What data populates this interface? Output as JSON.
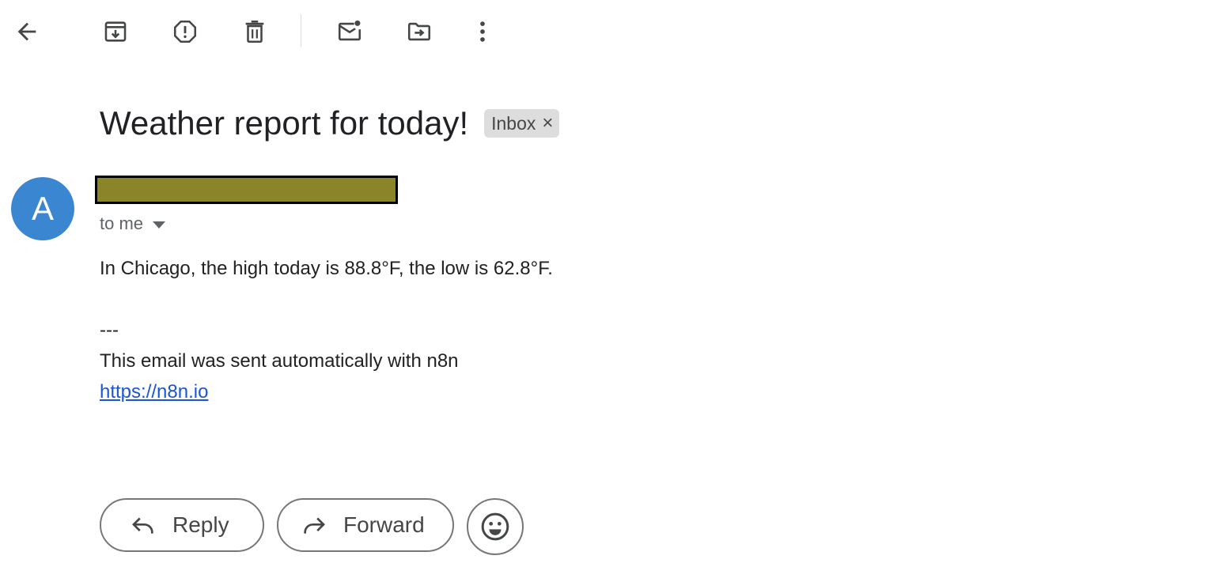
{
  "toolbar": {
    "buttons": [
      {
        "name": "back-button",
        "icon": "arrow-left-icon"
      },
      {
        "name": "archive-button",
        "icon": "archive-icon"
      },
      {
        "name": "report-spam-button",
        "icon": "report-spam-icon"
      },
      {
        "name": "delete-button",
        "icon": "trash-icon"
      },
      {
        "name": "mark-unread-button",
        "icon": "mail-unread-icon"
      },
      {
        "name": "move-to-button",
        "icon": "folder-move-icon"
      },
      {
        "name": "more-options-button",
        "icon": "more-vert-icon"
      }
    ]
  },
  "email": {
    "subject": "Weather report for today!",
    "label": "Inbox",
    "label_remove_glyph": "×",
    "sender_initial": "A",
    "recipients": "to me",
    "body_line1": "In Chicago, the high today is 88.8°F, the low is 62.8°F.",
    "signature_sep": "---",
    "signature_text": "This email was sent automatically with n8n",
    "signature_link": "https://n8n.io"
  },
  "actions": {
    "reply_label": "Reply",
    "forward_label": "Forward"
  },
  "colors": {
    "avatar": "#3b86d0",
    "link": "#1a55d8",
    "label_chip": "#dddddd",
    "redaction": "#8b8529"
  }
}
